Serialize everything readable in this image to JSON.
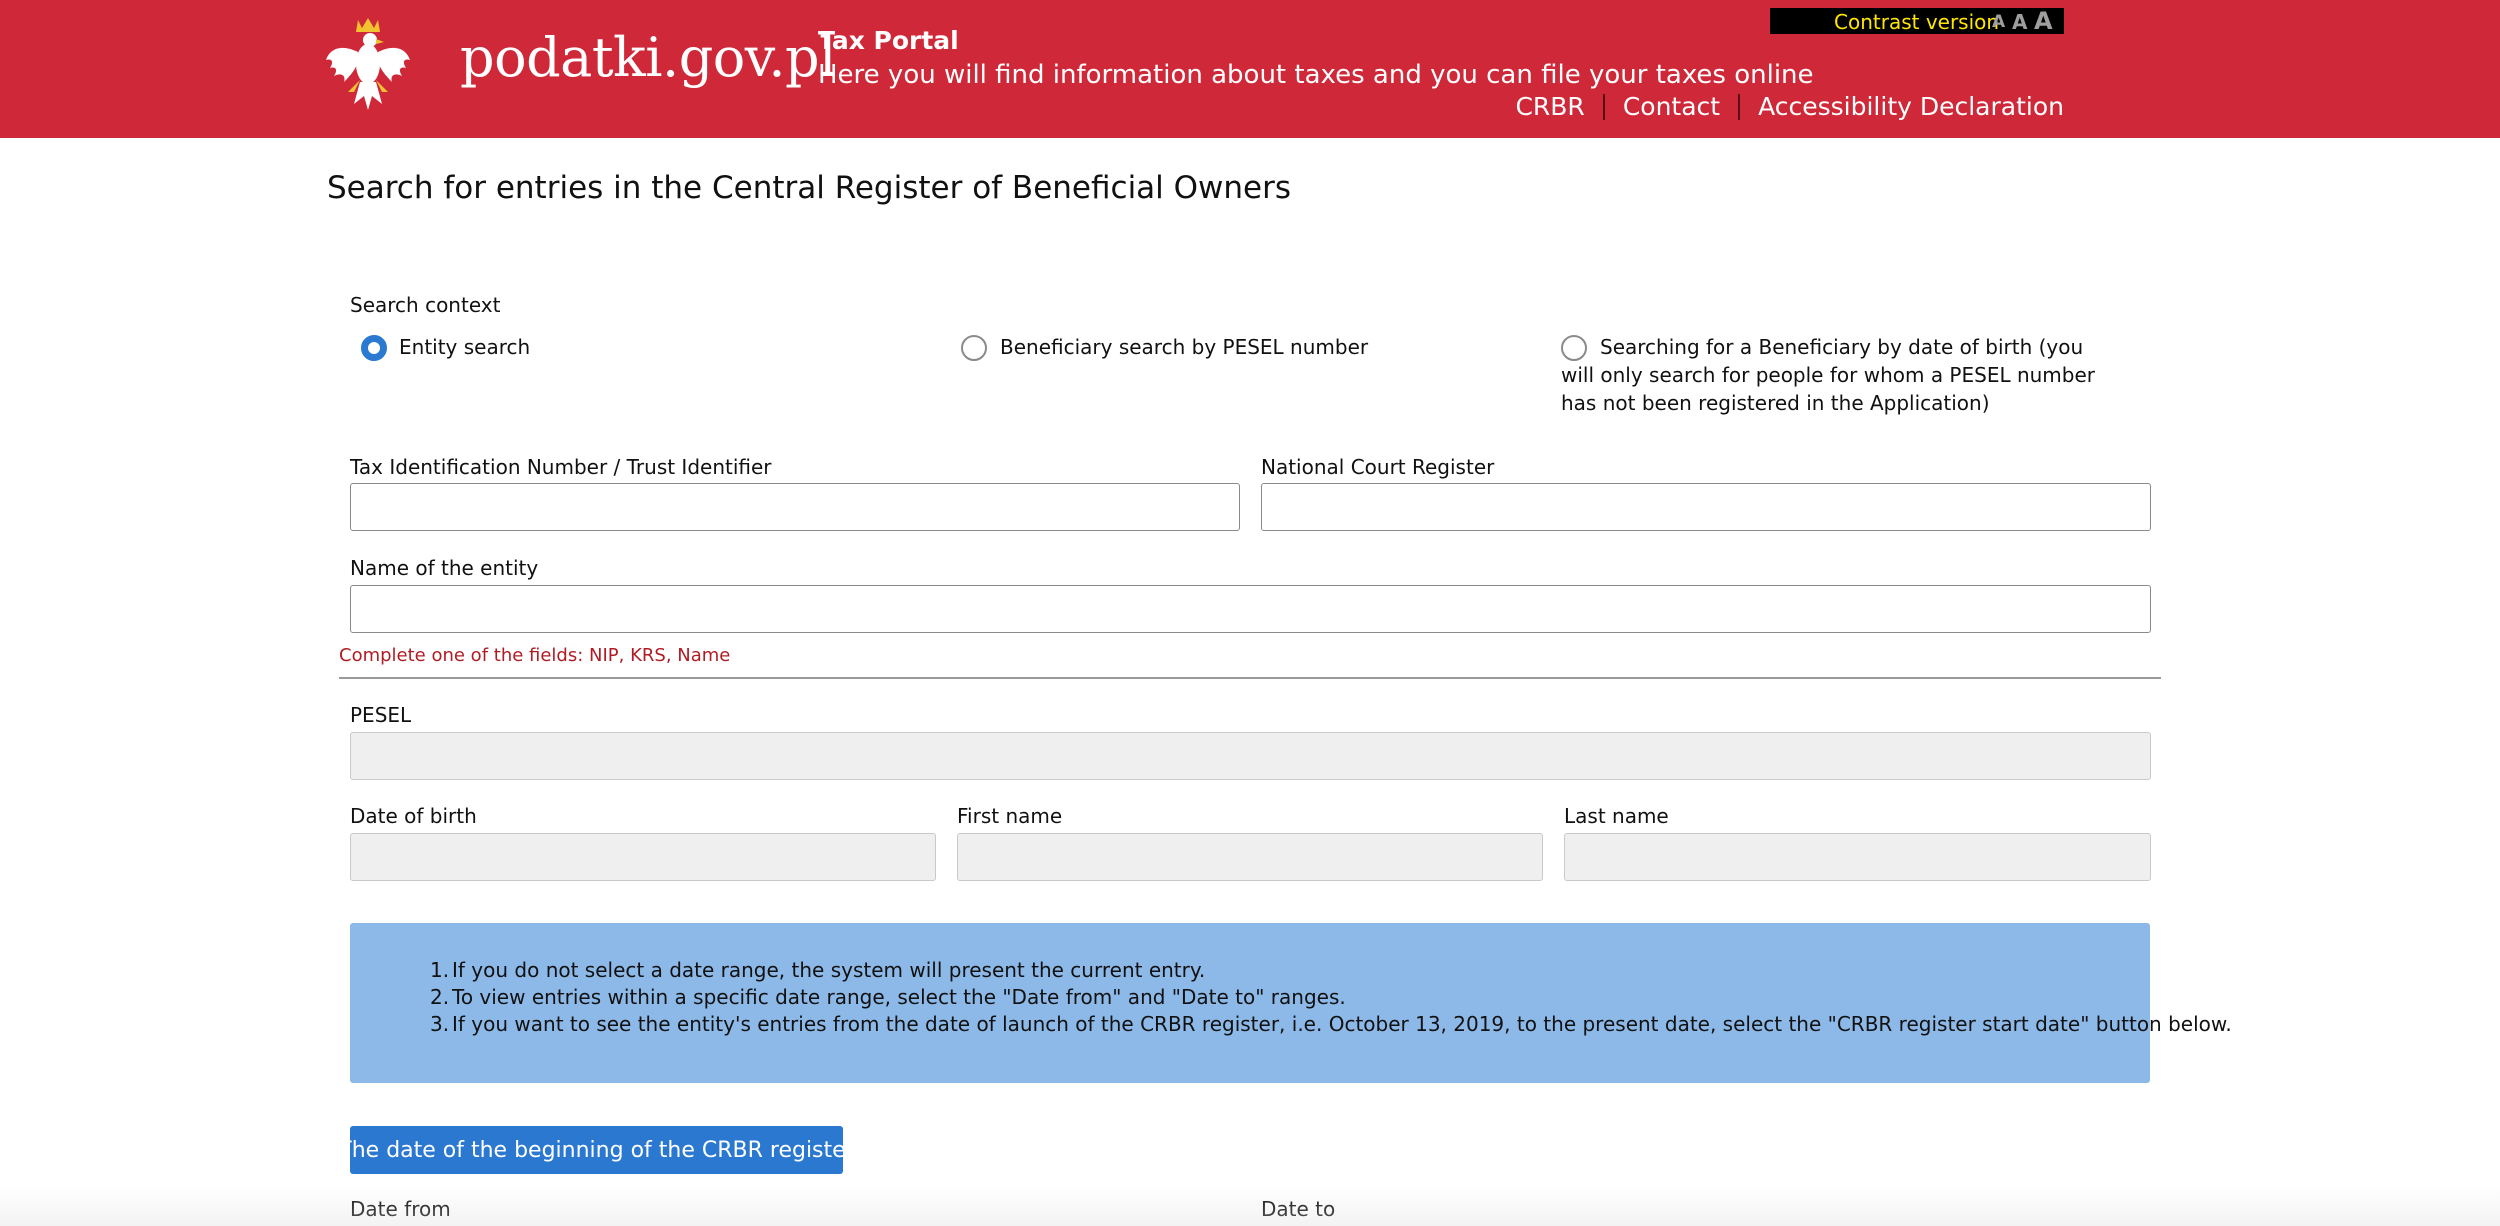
{
  "header": {
    "logo_text": "podatki.gov.pl",
    "portal_title": "Tax Portal",
    "portal_subtitle": "Here you will find information about taxes and you can file your taxes online",
    "contrast_label": "Contrast version",
    "font_size_labels": [
      "A",
      "A",
      "A"
    ],
    "nav": [
      "CRBR",
      "Contact",
      "Accessibility Declaration"
    ],
    "colors": {
      "brand_red": "#cf2839",
      "contrast_bar": "#000000",
      "contrast_text": "#ffe600"
    }
  },
  "page": {
    "title": "Search for entries in the Central Register of Beneficial Owners"
  },
  "search_context": {
    "label": "Search context",
    "options": [
      {
        "label": "Entity search",
        "selected": true
      },
      {
        "label": "Beneficiary search by PESEL number",
        "selected": false
      },
      {
        "label": "Searching for a Beneficiary by date of birth (you will only search for people for whom a PESEL number has not been registered in the Application)",
        "selected": false
      }
    ]
  },
  "entity_fields": {
    "nip_label": "Tax Identification Number / Trust Identifier",
    "nip_value": "",
    "krs_label": "National Court Register",
    "krs_value": "",
    "name_label": "Name of the entity",
    "name_value": "",
    "error": "Complete one of the fields: NIP, KRS, Name"
  },
  "person_fields": {
    "pesel_label": "PESEL",
    "dob_label": "Date of birth",
    "first_name_label": "First name",
    "last_name_label": "Last name"
  },
  "info": {
    "items": [
      "If you do not select a date range, the system will present the current entry.",
      "To view entries within a specific date range, select the \"Date from\" and \"Date to\" ranges.",
      "If you want to see the entity's entries from the date of launch of the CRBR register, i.e. October 13, 2019, to the present date, select the \"CRBR register start date\" button below."
    ],
    "numbers": [
      "1.",
      "2.",
      "3."
    ],
    "color": "#8db9e8"
  },
  "actions": {
    "register_start_button": "The date of the beginning of the CRBR register",
    "button_color": "#2b78d1"
  },
  "date_range": {
    "from_label": "Date from",
    "to_label": "Date to"
  }
}
